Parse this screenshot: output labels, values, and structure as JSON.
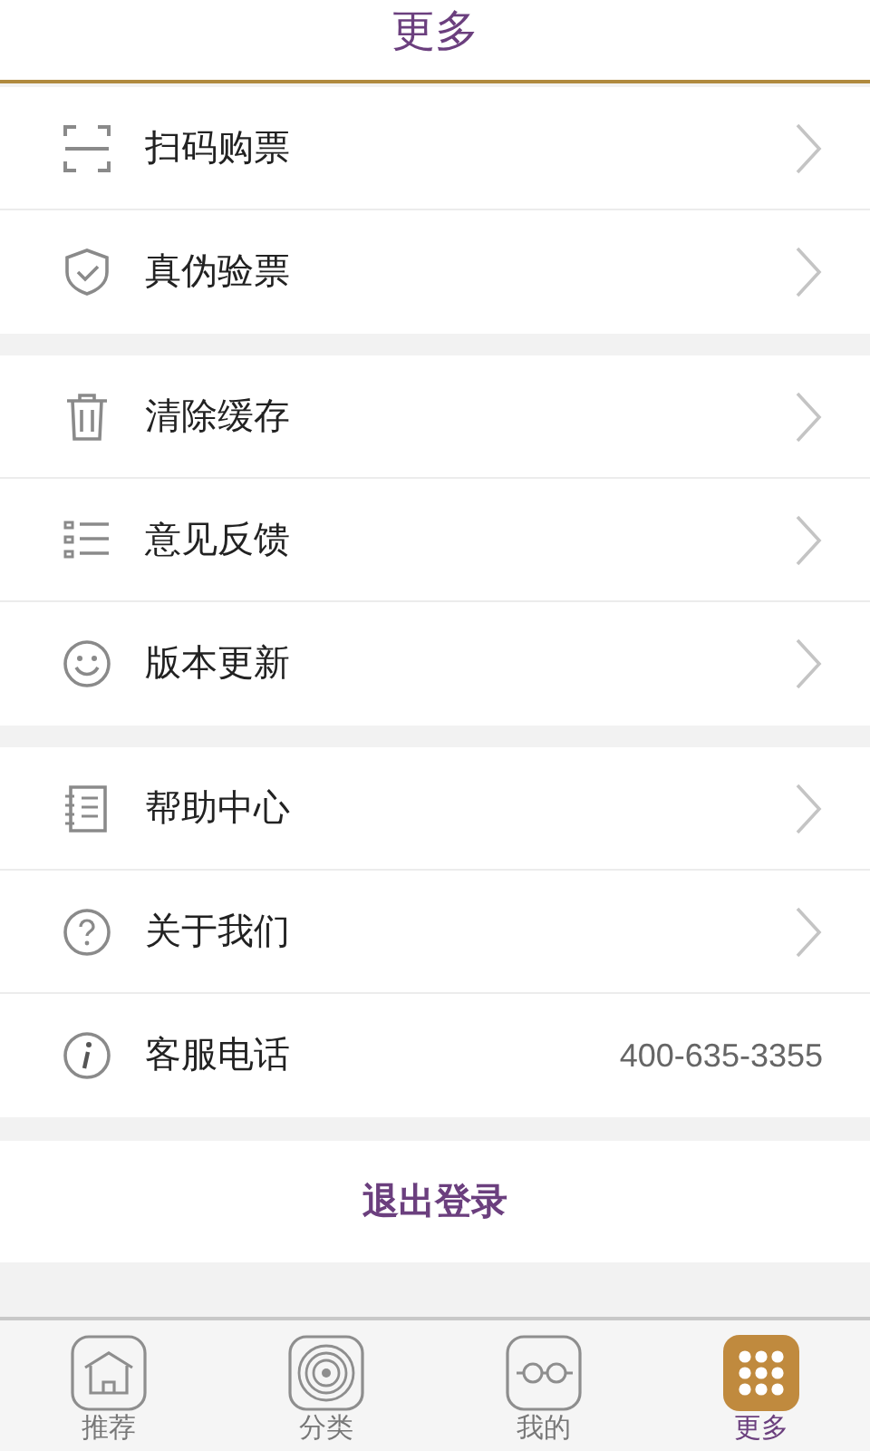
{
  "header": {
    "title": "更多"
  },
  "groups": [
    {
      "items": [
        {
          "kind": "link",
          "label": "扫码购票"
        },
        {
          "kind": "link",
          "label": "真伪验票"
        }
      ]
    },
    {
      "items": [
        {
          "kind": "link",
          "label": "清除缓存"
        },
        {
          "kind": "link",
          "label": "意见反馈"
        },
        {
          "kind": "link",
          "label": "版本更新"
        }
      ]
    },
    {
      "items": [
        {
          "kind": "link",
          "label": "帮助中心"
        },
        {
          "kind": "link",
          "label": "关于我们"
        },
        {
          "kind": "phone",
          "label": "客服电话",
          "value": "400-635-3355"
        }
      ]
    }
  ],
  "logout": {
    "label": "退出登录"
  },
  "tabs": [
    {
      "label": "推荐",
      "selected": false
    },
    {
      "label": "分类",
      "selected": false
    },
    {
      "label": "我的",
      "selected": false
    },
    {
      "label": "更多",
      "selected": true
    }
  ]
}
